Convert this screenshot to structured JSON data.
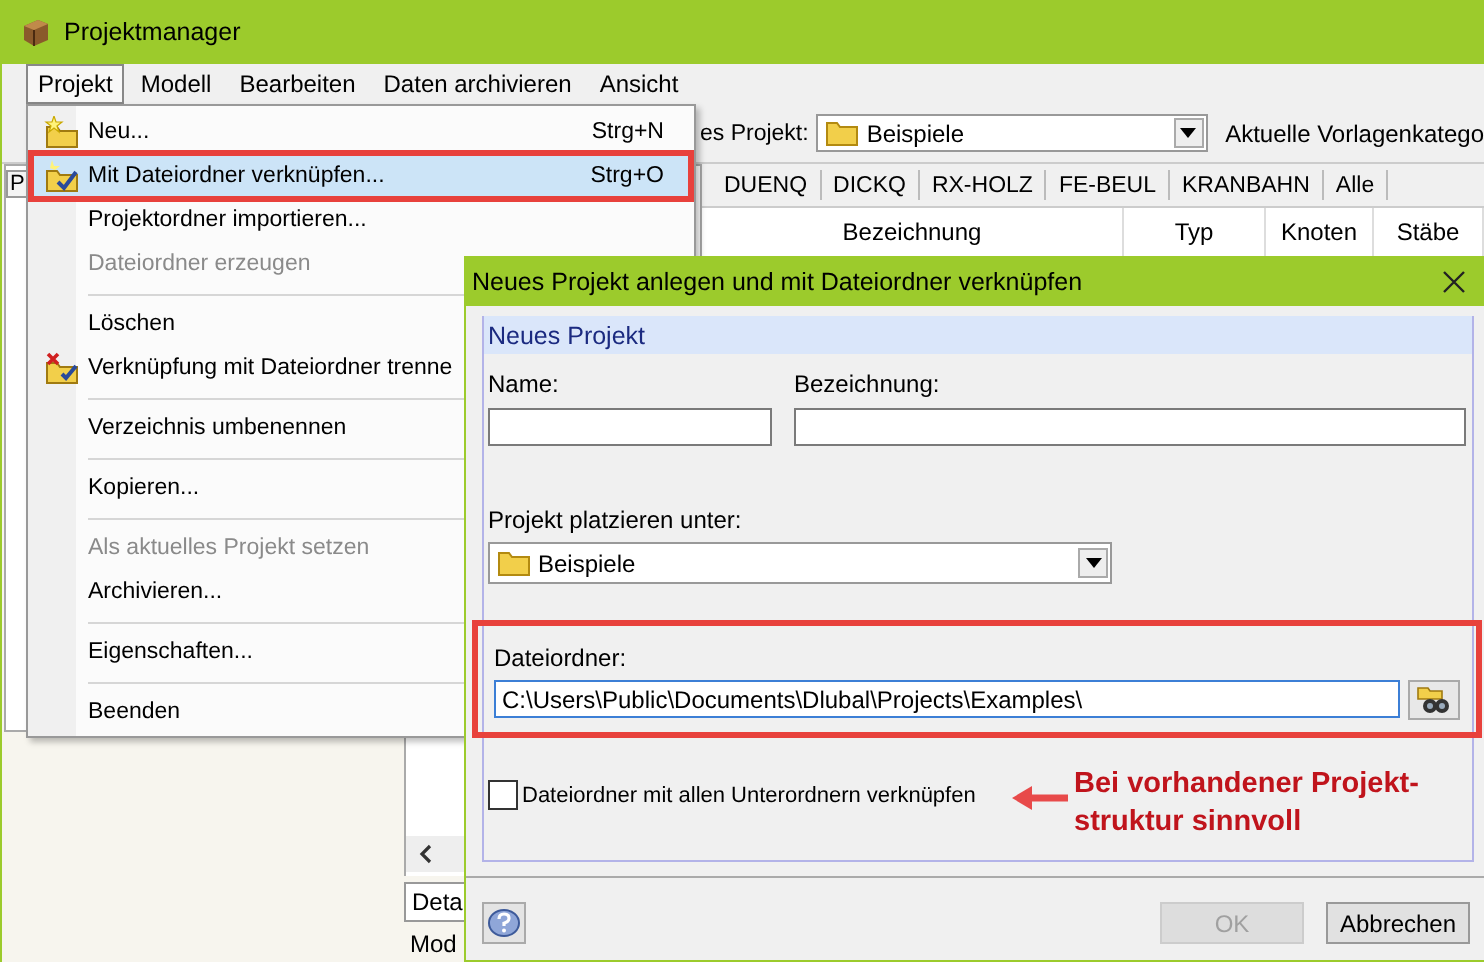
{
  "window": {
    "title": "Projektmanager"
  },
  "menubar": [
    {
      "label": "Projekt",
      "selected": true
    },
    {
      "label": "Modell",
      "selected": false
    },
    {
      "label": "Bearbeiten",
      "selected": false
    },
    {
      "label": "Daten archivieren",
      "selected": false
    },
    {
      "label": "Ansicht",
      "selected": false
    }
  ],
  "toolbar": {
    "project_label": "es Projekt:",
    "project_combo": "Beispiele",
    "category_label": "Aktuelle Vorlagenkatego"
  },
  "left_panel": {
    "tab": "P",
    "bottom_tab": "Deta",
    "bottom_text": "Mod"
  },
  "category_tabs": [
    "DUENQ",
    "DICKQ",
    "RX-HOLZ",
    "FE-BEUL",
    "KRANBAHN",
    "Alle"
  ],
  "table": {
    "columns": [
      "Bezeichnung",
      "Typ",
      "Knoten",
      "Stäbe"
    ]
  },
  "menu": {
    "items": [
      {
        "kind": "item",
        "label": "Neu...",
        "shortcut": "Strg+N",
        "selected": false,
        "disabled": false,
        "highlighted": false
      },
      {
        "kind": "item",
        "label": "Mit Dateiordner verknüpfen...",
        "shortcut": "Strg+O",
        "selected": true,
        "disabled": false,
        "highlighted": true
      },
      {
        "kind": "item",
        "label": "Projektordner importieren...",
        "selected": false,
        "disabled": false,
        "highlighted": false
      },
      {
        "kind": "item",
        "label": "Dateiordner erzeugen",
        "selected": false,
        "disabled": true,
        "highlighted": false
      },
      {
        "kind": "separator"
      },
      {
        "kind": "item",
        "label": "Löschen",
        "selected": false,
        "disabled": false,
        "highlighted": false
      },
      {
        "kind": "item",
        "label": "Verknüpfung mit Dateiordner trenne",
        "selected": false,
        "disabled": false,
        "highlighted": false
      },
      {
        "kind": "separator"
      },
      {
        "kind": "item",
        "label": "Verzeichnis umbenennen",
        "selected": false,
        "disabled": false,
        "highlighted": false
      },
      {
        "kind": "separator"
      },
      {
        "kind": "item",
        "label": "Kopieren...",
        "selected": false,
        "disabled": false,
        "highlighted": false
      },
      {
        "kind": "separator"
      },
      {
        "kind": "item",
        "label": "Als aktuelles Projekt setzen",
        "selected": false,
        "disabled": true,
        "highlighted": false
      },
      {
        "kind": "item",
        "label": "Archivieren...",
        "selected": false,
        "disabled": false,
        "highlighted": false
      },
      {
        "kind": "separator"
      },
      {
        "kind": "item",
        "label": "Eigenschaften...",
        "selected": false,
        "disabled": false,
        "highlighted": false
      },
      {
        "kind": "separator"
      },
      {
        "kind": "item",
        "label": "Beenden",
        "selected": false,
        "disabled": false,
        "highlighted": false
      }
    ]
  },
  "dialog": {
    "title": "Neues Projekt anlegen und mit Dateiordner verknüpfen",
    "group_title": "Neues Projekt",
    "name_label": "Name:",
    "designation_label": "Bezeichnung:",
    "place_label": "Projekt platzieren unter:",
    "place_value": "Beispiele",
    "folder": {
      "label": "Dateiordner:",
      "value": "C:\\Users\\Public\\Documents\\Dlubal\\Projects\\Examples\\",
      "highlighted": true
    },
    "subfolders": {
      "label": "Dateiordner mit allen Unterordnern verknüpfen",
      "checked": false
    },
    "buttons": [
      {
        "label": "OK",
        "disabled": true
      },
      {
        "label": "Abbrechen",
        "disabled": false
      }
    ]
  },
  "annotation": {
    "lines": [
      "Bei vorhandener Projekt-",
      "struktur sinnvoll"
    ]
  }
}
